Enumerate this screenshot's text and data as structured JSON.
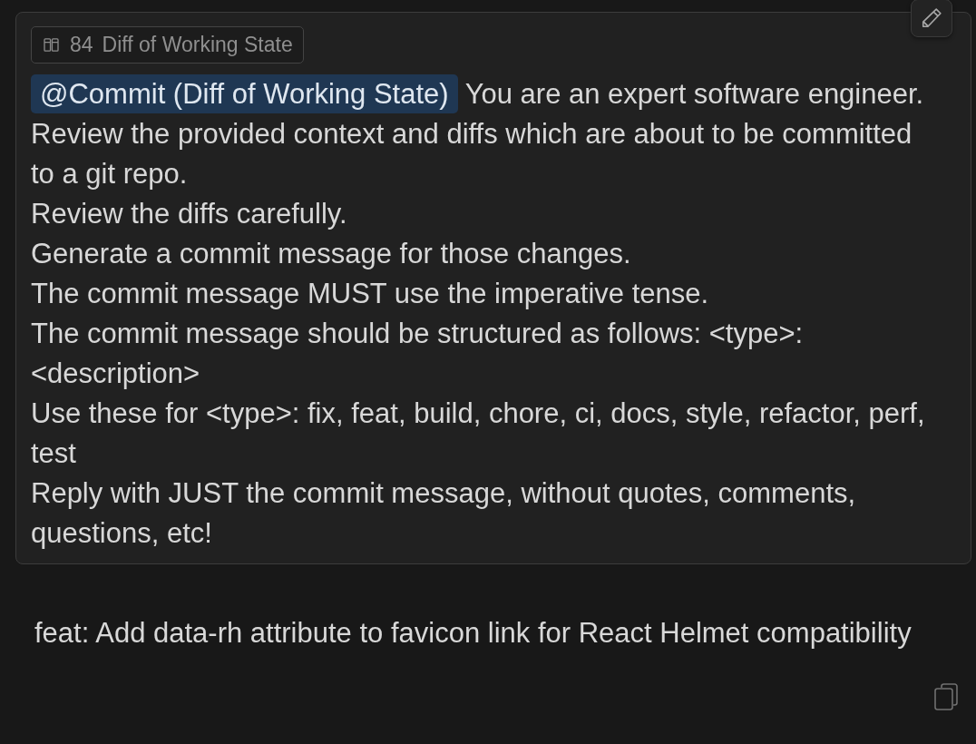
{
  "prompt": {
    "context_chip": {
      "count": "84",
      "label": "Diff of Working State"
    },
    "mention": "@Commit (Diff of Working State)",
    "paragraphs": [
      "You are an expert software engineer.",
      "Review the provided context and diffs which are about to be committed to a git repo.",
      "Review the diffs carefully.",
      "Generate a commit message for those changes.",
      "The commit message MUST use the imperative tense.",
      "The commit message should be structured as follows: <type>: <description>",
      "Use these for <type>: fix, feat, build, chore, ci, docs, style, refactor, perf, test",
      "Reply with JUST the commit message, without quotes, comments, questions, etc!"
    ]
  },
  "response": {
    "text": "feat: Add data-rh attribute to favicon link for React Helmet compatibility"
  }
}
